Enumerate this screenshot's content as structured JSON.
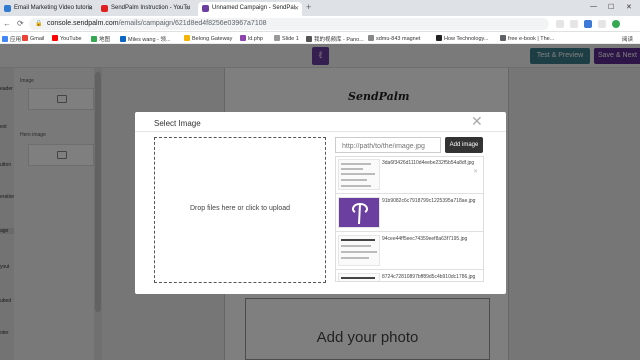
{
  "browser": {
    "tabs": [
      {
        "label": "Email Marketing Video tutoria",
        "favicon_color": "#2f7bd1"
      },
      {
        "label": "SendPalm Instruction - YouTu",
        "favicon_color": "#e02020"
      },
      {
        "label": "Unnamed Campaign - SendPal",
        "favicon_color": "#6b3fa0"
      }
    ],
    "new_tab_symbol": "+",
    "window_controls": {
      "minimize": "—",
      "maximize": "☐",
      "close": "✕"
    },
    "url_host": "console.sendpalm.com",
    "url_path": "/emails/campaign/621d8ed4f8256e03967a7108",
    "bookmarks": [
      {
        "label": "应用",
        "color": "#4285f4"
      },
      {
        "label": "Gmail",
        "color": "#ea4335"
      },
      {
        "label": "YouTube",
        "color": "#ff0000"
      },
      {
        "label": "地图",
        "color": "#34a853"
      },
      {
        "label": "Miles wang - 领...",
        "color": "#0a66c2"
      },
      {
        "label": "Belong Gateway",
        "color": "#f4b400"
      },
      {
        "label": "ld.php",
        "color": "#8e44ad"
      },
      {
        "label": "Slide 1",
        "color": "#999999"
      },
      {
        "label": "我的视频库 - Pano...",
        "color": "#555555"
      },
      {
        "label": "sdmu-843 magnet",
        "color": "#888888"
      },
      {
        "label": "How Technology...",
        "color": "#222222"
      },
      {
        "label": "free e-book | The...",
        "color": "#5f6368"
      },
      {
        "label": "阅读",
        "color": "#5f6368"
      }
    ]
  },
  "app": {
    "buttons": {
      "test_preview": "Test & Preview",
      "save_next": "Save & Next"
    },
    "logo_glyph": "ℓ",
    "left_rail": [
      "eader",
      "ext",
      "utton",
      "eration",
      "age",
      "yout",
      "ubed",
      "oter"
    ],
    "panel": {
      "image_label": "Image",
      "hero_image_label": "Hero image"
    },
    "canvas": {
      "brand_text": "SendPalm",
      "add_photo_text": "Add your photo"
    }
  },
  "modal": {
    "title": "Select Image",
    "close_symbol": "✕",
    "dropzone_text": "Drop files here or click to upload",
    "path_placeholder": "http://path/to/the/image.jpg",
    "add_image_label": "Add image",
    "delete_symbol": "✕",
    "images": [
      {
        "filename": "3da6f3426d1110d4eebe232f5b54a8df.jpg",
        "thumb": "screenshot"
      },
      {
        "filename": "91b9082c6c7918799c1225395a718ae.jpg",
        "thumb": "logo"
      },
      {
        "filename": "94cee44ff5eec74359eef8a63f7195.jpg",
        "thumb": "document"
      },
      {
        "filename": "8724c72810897bff89d5c4b910dc1786.jpg",
        "thumb": "document"
      }
    ]
  }
}
